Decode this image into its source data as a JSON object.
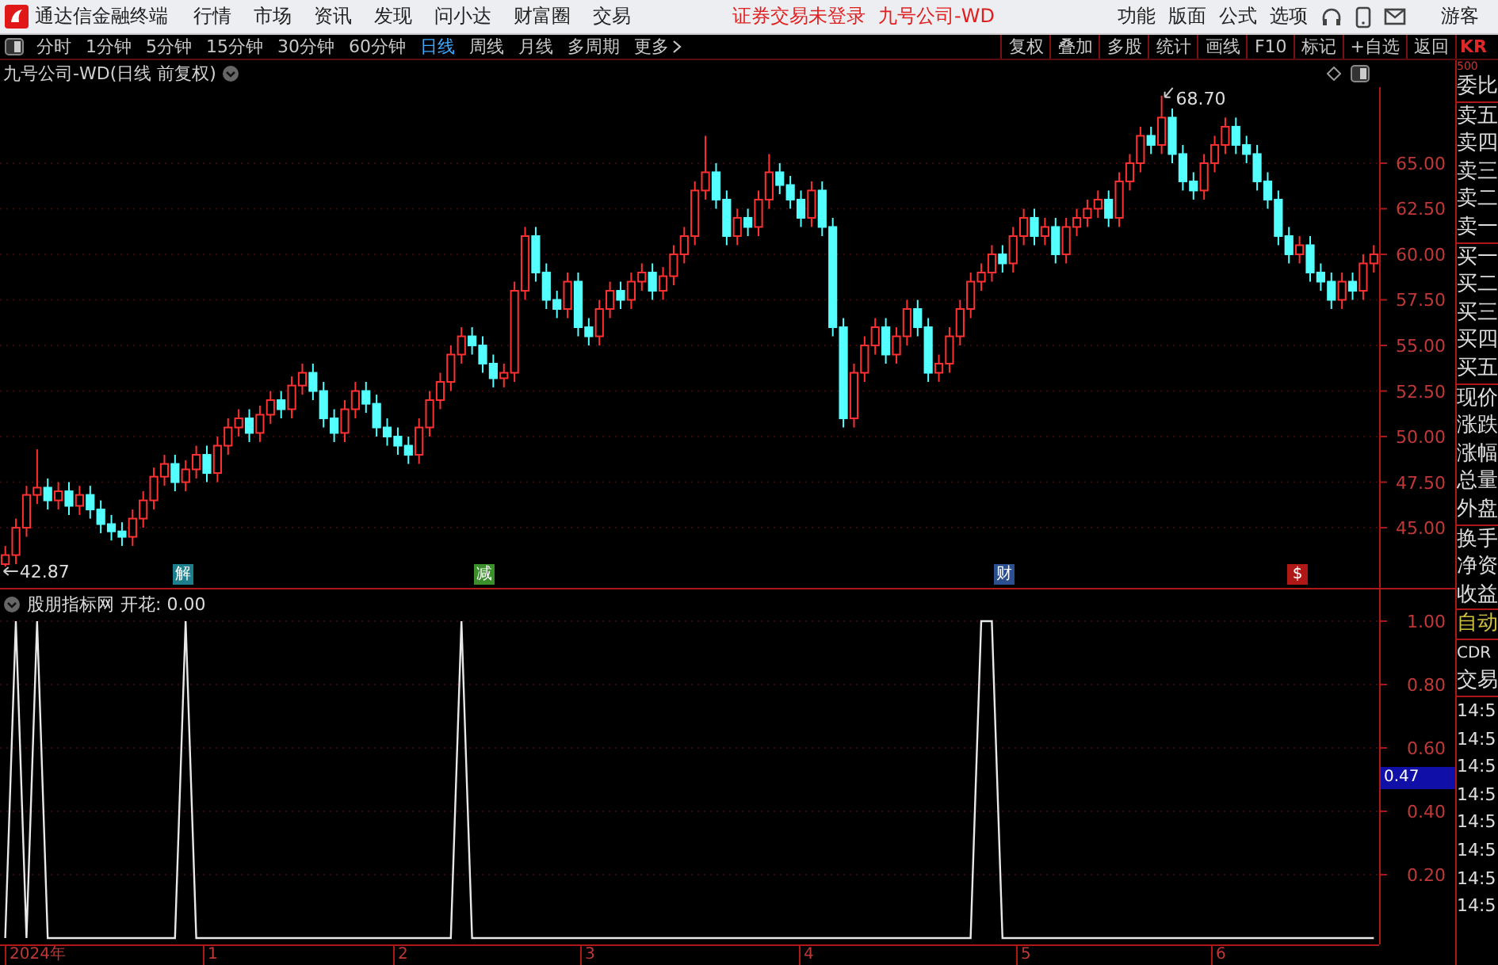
{
  "app": {
    "title": "通达信金融终端"
  },
  "menu": [
    "行情",
    "市场",
    "资讯",
    "发现",
    "问小达",
    "财富圈",
    "交易"
  ],
  "login_status": "证券交易未登录",
  "stock_name": "九号公司-WD",
  "top_menu": [
    "功能",
    "版面",
    "公式",
    "选项"
  ],
  "user": "游客",
  "periods": [
    {
      "label": "分时",
      "selected": false
    },
    {
      "label": "1分钟",
      "selected": false
    },
    {
      "label": "5分钟",
      "selected": false
    },
    {
      "label": "15分钟",
      "selected": false
    },
    {
      "label": "30分钟",
      "selected": false
    },
    {
      "label": "60分钟",
      "selected": false
    },
    {
      "label": "日线",
      "selected": true
    },
    {
      "label": "周线",
      "selected": false
    },
    {
      "label": "月线",
      "selected": false
    },
    {
      "label": "多周期",
      "selected": false
    },
    {
      "label": "更多",
      "selected": false
    }
  ],
  "tools": [
    "复权",
    "叠加",
    "多股",
    "统计",
    "画线",
    "F10",
    "标记",
    "+自选",
    "返回"
  ],
  "quote_code": {
    "code": "KR",
    "sub": "500"
  },
  "chart": {
    "title": "九号公司-WD(日线 前复权)",
    "high_label": "68.70",
    "low_label": "42.87",
    "events": [
      {
        "text": "解",
        "color": "#1d7f8c"
      },
      {
        "text": "减",
        "color": "#3a8f2a"
      },
      {
        "text": "财",
        "color": "#2c4f8f"
      },
      {
        "text": "$",
        "color": "#b01818"
      }
    ],
    "chart_data": {
      "type": "candlestick",
      "ylim": [
        41.7,
        69.17
      ],
      "grid": true,
      "yticks": [
        {
          "value": 65,
          "label": "65.00"
        },
        {
          "value": 62.5,
          "label": "62.50"
        },
        {
          "value": 60,
          "label": "60.00"
        },
        {
          "value": 57.5,
          "label": "57.50"
        },
        {
          "value": 55,
          "label": "55.00"
        },
        {
          "value": 52.5,
          "label": "52.50"
        },
        {
          "value": 50,
          "label": "50.00"
        },
        {
          "value": 47.5,
          "label": "47.50"
        },
        {
          "value": 45,
          "label": "45.00"
        }
      ],
      "ohlc": [
        [
          43,
          44,
          42.87,
          43.5
        ],
        [
          43.5,
          45.5,
          43,
          45
        ],
        [
          45,
          47.3,
          44.5,
          46.8
        ],
        [
          46.8,
          49.3,
          46.3,
          47.2
        ],
        [
          47.2,
          47.7,
          46,
          46.5
        ],
        [
          46.5,
          47.5,
          46,
          47
        ],
        [
          47,
          47.5,
          45.7,
          46.2
        ],
        [
          46.2,
          47.3,
          45.7,
          46.8
        ],
        [
          46.8,
          47.3,
          45.5,
          46
        ],
        [
          46,
          46.5,
          44.7,
          45.2
        ],
        [
          45.2,
          45.7,
          44.3,
          44.8
        ],
        [
          44.8,
          45.3,
          44,
          44.5
        ],
        [
          44.5,
          46,
          44,
          45.5
        ],
        [
          45.5,
          47,
          45,
          46.5
        ],
        [
          46.5,
          48.3,
          46,
          47.8
        ],
        [
          47.8,
          49,
          47.3,
          48.5
        ],
        [
          48.5,
          49,
          47,
          47.5
        ],
        [
          47.5,
          48.7,
          47,
          48.2
        ],
        [
          48.2,
          49.5,
          47.7,
          49
        ],
        [
          49,
          49.5,
          47.5,
          48
        ],
        [
          48,
          50,
          47.5,
          49.5
        ],
        [
          49.5,
          51,
          49,
          50.5
        ],
        [
          50.5,
          51.5,
          50,
          51
        ],
        [
          51,
          51.5,
          49.7,
          50.2
        ],
        [
          50.2,
          51.7,
          49.7,
          51.2
        ],
        [
          51.2,
          52.5,
          50.7,
          52
        ],
        [
          52,
          52.5,
          51,
          51.5
        ],
        [
          51.5,
          53.3,
          51,
          52.8
        ],
        [
          52.8,
          54,
          52.3,
          53.5
        ],
        [
          53.5,
          54,
          52,
          52.5
        ],
        [
          52.5,
          53,
          50.5,
          51
        ],
        [
          51,
          51.5,
          49.7,
          50.2
        ],
        [
          50.2,
          52,
          49.7,
          51.5
        ],
        [
          51.5,
          53,
          51,
          52.5
        ],
        [
          52.5,
          53,
          51.3,
          51.8
        ],
        [
          51.8,
          52.3,
          50,
          50.5
        ],
        [
          50.5,
          51,
          49.5,
          50
        ],
        [
          50,
          50.5,
          49,
          49.5
        ],
        [
          49.5,
          50,
          48.5,
          49
        ],
        [
          49,
          51,
          48.5,
          50.5
        ],
        [
          50.5,
          52.5,
          50,
          52
        ],
        [
          52,
          53.5,
          51.5,
          53
        ],
        [
          53,
          55,
          52.5,
          54.5
        ],
        [
          54.5,
          56,
          54,
          55.5
        ],
        [
          55.5,
          56,
          54.5,
          55
        ],
        [
          55,
          55.5,
          53.5,
          54
        ],
        [
          54,
          54.5,
          52.7,
          53.2
        ],
        [
          53.2,
          54,
          52.7,
          53.5
        ],
        [
          53.5,
          58.5,
          53,
          58
        ],
        [
          58,
          61.5,
          57.5,
          61
        ],
        [
          61,
          61.5,
          58.5,
          59
        ],
        [
          59,
          59.5,
          57,
          57.5
        ],
        [
          57.5,
          58,
          56.5,
          57
        ],
        [
          57,
          59,
          56.5,
          58.5
        ],
        [
          58.5,
          59,
          55.5,
          56
        ],
        [
          56,
          56.5,
          55,
          55.5
        ],
        [
          55.5,
          57.5,
          55,
          57
        ],
        [
          57,
          58.5,
          56.5,
          58
        ],
        [
          58,
          58.5,
          57,
          57.5
        ],
        [
          57.5,
          59,
          57,
          58.5
        ],
        [
          58.5,
          59.5,
          58,
          59
        ],
        [
          59,
          59.5,
          57.5,
          58
        ],
        [
          58,
          59.3,
          57.5,
          58.8
        ],
        [
          58.8,
          60.5,
          58.3,
          60
        ],
        [
          60,
          61.5,
          59.5,
          61
        ],
        [
          61,
          64,
          60.5,
          63.5
        ],
        [
          63.5,
          66.5,
          63,
          64.5
        ],
        [
          64.5,
          65,
          62.5,
          63
        ],
        [
          63,
          63.5,
          60.5,
          61
        ],
        [
          61,
          62.5,
          60.5,
          62
        ],
        [
          62,
          62.5,
          61,
          61.5
        ],
        [
          61.5,
          63.5,
          61,
          63
        ],
        [
          63,
          65.5,
          62.5,
          64.5
        ],
        [
          64.5,
          65,
          63.3,
          63.8
        ],
        [
          63.8,
          64.3,
          62.5,
          63
        ],
        [
          63,
          63.5,
          61.5,
          62
        ],
        [
          62,
          64,
          61.5,
          63.5
        ],
        [
          63.5,
          64,
          61,
          61.5
        ],
        [
          61.5,
          62,
          55.5,
          56
        ],
        [
          56,
          56.5,
          50.5,
          51
        ],
        [
          51,
          54,
          50.5,
          53.5
        ],
        [
          53.5,
          55.5,
          53,
          55
        ],
        [
          55,
          56.5,
          54.5,
          56
        ],
        [
          56,
          56.5,
          54,
          54.5
        ],
        [
          54.5,
          56,
          54,
          55.5
        ],
        [
          55.5,
          57.5,
          55,
          57
        ],
        [
          57,
          57.5,
          55.5,
          56
        ],
        [
          56,
          56.5,
          53,
          53.5
        ],
        [
          53.5,
          54.5,
          53,
          54
        ],
        [
          54,
          56,
          53.5,
          55.5
        ],
        [
          55.5,
          57.5,
          55,
          57
        ],
        [
          57,
          59,
          56.5,
          58.5
        ],
        [
          58.5,
          59.5,
          58,
          59
        ],
        [
          59,
          60.5,
          58.5,
          60
        ],
        [
          60,
          60.5,
          59,
          59.5
        ],
        [
          59.5,
          61.5,
          59,
          61
        ],
        [
          61,
          62.5,
          60.5,
          62
        ],
        [
          62,
          62.5,
          60.5,
          61
        ],
        [
          61,
          62,
          60.5,
          61.5
        ],
        [
          61.5,
          62,
          59.5,
          60
        ],
        [
          60,
          62,
          59.5,
          61.5
        ],
        [
          61.5,
          62.5,
          61,
          62
        ],
        [
          62,
          63,
          61.5,
          62.5
        ],
        [
          62.5,
          63.5,
          62,
          63
        ],
        [
          63,
          63.5,
          61.5,
          62
        ],
        [
          62,
          64.5,
          61.5,
          64
        ],
        [
          64,
          65.5,
          63.5,
          65
        ],
        [
          65,
          67,
          64.5,
          66.5
        ],
        [
          66.5,
          67,
          65.5,
          66
        ],
        [
          66,
          68.7,
          65.5,
          67.5
        ],
        [
          67.5,
          68,
          65,
          65.5
        ],
        [
          65.5,
          66,
          63.5,
          64
        ],
        [
          64,
          64.5,
          63,
          63.5
        ],
        [
          63.5,
          65.5,
          63,
          65
        ],
        [
          65,
          66.5,
          64.5,
          66
        ],
        [
          66,
          67.5,
          65.5,
          67
        ],
        [
          67,
          67.5,
          65.5,
          66
        ],
        [
          66,
          66.5,
          65,
          65.5
        ],
        [
          65.5,
          66,
          63.5,
          64
        ],
        [
          64,
          64.5,
          62.5,
          63
        ],
        [
          63,
          63.5,
          60.5,
          61
        ],
        [
          61,
          61.5,
          59.5,
          60
        ],
        [
          60,
          61,
          59.5,
          60.5
        ],
        [
          60.5,
          61,
          58.5,
          59
        ],
        [
          59,
          59.5,
          58,
          58.5
        ],
        [
          58.5,
          59,
          57,
          57.5
        ],
        [
          57.5,
          59,
          57,
          58.5
        ],
        [
          58.5,
          59,
          57.5,
          58
        ],
        [
          58,
          60,
          57.5,
          59.5
        ],
        [
          59.5,
          60.5,
          59,
          60
        ]
      ]
    }
  },
  "indicator": {
    "name": "股朋指标网",
    "value_label": ": 0.00",
    "cursor_value": "0.47",
    "chart_data": {
      "type": "line",
      "ylim": [
        -0.02,
        1.1
      ],
      "grid": true,
      "yticks": [
        {
          "value": 1,
          "label": "1.00"
        },
        {
          "value": 0.8,
          "label": "0.80"
        },
        {
          "value": 0.6,
          "label": "0.60"
        },
        {
          "value": 0.4,
          "label": "0.40"
        },
        {
          "value": 0.2,
          "label": "0.20"
        }
      ],
      "series": [
        {
          "name": "开花",
          "color": "#e8e8e8",
          "values": [
            0,
            1,
            0,
            1,
            0,
            0,
            0,
            0,
            0,
            0,
            0,
            0,
            0,
            0,
            0,
            0,
            0,
            1,
            0,
            0,
            0,
            0,
            0,
            0,
            0,
            0,
            0,
            0,
            0,
            0,
            0,
            0,
            0,
            0,
            0,
            0,
            0,
            0,
            0,
            0,
            0,
            0,
            0,
            1,
            0,
            0,
            0,
            0,
            0,
            0,
            0,
            0,
            0,
            0,
            0,
            0,
            0,
            0,
            0,
            0,
            0,
            0,
            0,
            0,
            0,
            0,
            0,
            0,
            0,
            0,
            0,
            0,
            0,
            0,
            0,
            0,
            0,
            0,
            0,
            0,
            0,
            0,
            0,
            0,
            0,
            0,
            0,
            0,
            0,
            0,
            0,
            0,
            1,
            1,
            0,
            0,
            0,
            0,
            0,
            0,
            0,
            0,
            0,
            0,
            0,
            0,
            0,
            0,
            0,
            0,
            0,
            0,
            0,
            0,
            0,
            0,
            0,
            0,
            0,
            0,
            0,
            0,
            0,
            0,
            0,
            0,
            0,
            0,
            0,
            0
          ]
        }
      ]
    }
  },
  "date_axis": [
    "2024年",
    "1",
    "2",
    "3",
    "4",
    "5",
    "6"
  ],
  "quote_panel": {
    "labels": [
      "委比",
      "卖五",
      "卖四",
      "卖三",
      "卖二",
      "卖一",
      "买一",
      "买二",
      "买三",
      "买四",
      "买五",
      "现价",
      "涨跌",
      "涨幅",
      "总量",
      "外盘",
      "换手",
      "净资",
      "收益"
    ],
    "mode": "自动",
    "extra": [
      "CDR",
      "交易"
    ],
    "times": [
      "14:5",
      "14:5",
      "14:5",
      "14:5",
      "14:5",
      "14:5",
      "14:5",
      "14:5"
    ]
  }
}
